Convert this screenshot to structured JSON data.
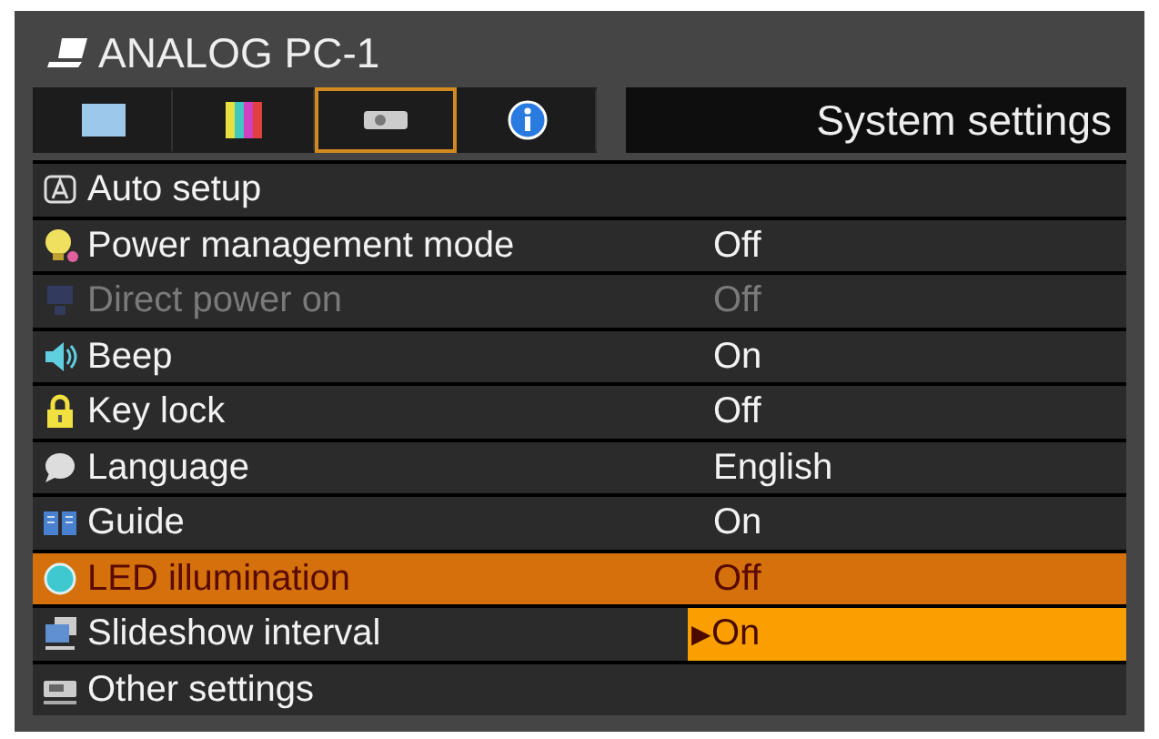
{
  "window": {
    "title": "ANALOG PC-1"
  },
  "tabs": [
    {
      "selected": false
    },
    {
      "selected": false
    },
    {
      "selected": true
    },
    {
      "selected": false
    }
  ],
  "section_title": "System settings",
  "rows": [
    {
      "label": "Auto setup",
      "selected": false,
      "disabled": false
    },
    {
      "label": "Power management mode",
      "value": "Off",
      "selected": false,
      "disabled": false
    },
    {
      "label": "Direct power on",
      "value": "Off",
      "selected": false,
      "disabled": true
    },
    {
      "label": "Beep",
      "value": "On",
      "selected": false,
      "disabled": false
    },
    {
      "label": "Key lock",
      "value": "Off",
      "selected": false,
      "disabled": false
    },
    {
      "label": "Language",
      "value": "English",
      "selected": false,
      "disabled": false
    },
    {
      "label": "Guide",
      "value": "On",
      "selected": false,
      "disabled": false
    },
    {
      "label": "LED illumination",
      "value": "Off",
      "selected": true,
      "disabled": false
    },
    {
      "label": "Slideshow interval",
      "value": "On",
      "value_cursor": "▶",
      "selected": false,
      "disabled": false
    },
    {
      "label": "Other settings",
      "selected": false,
      "disabled": false
    }
  ]
}
